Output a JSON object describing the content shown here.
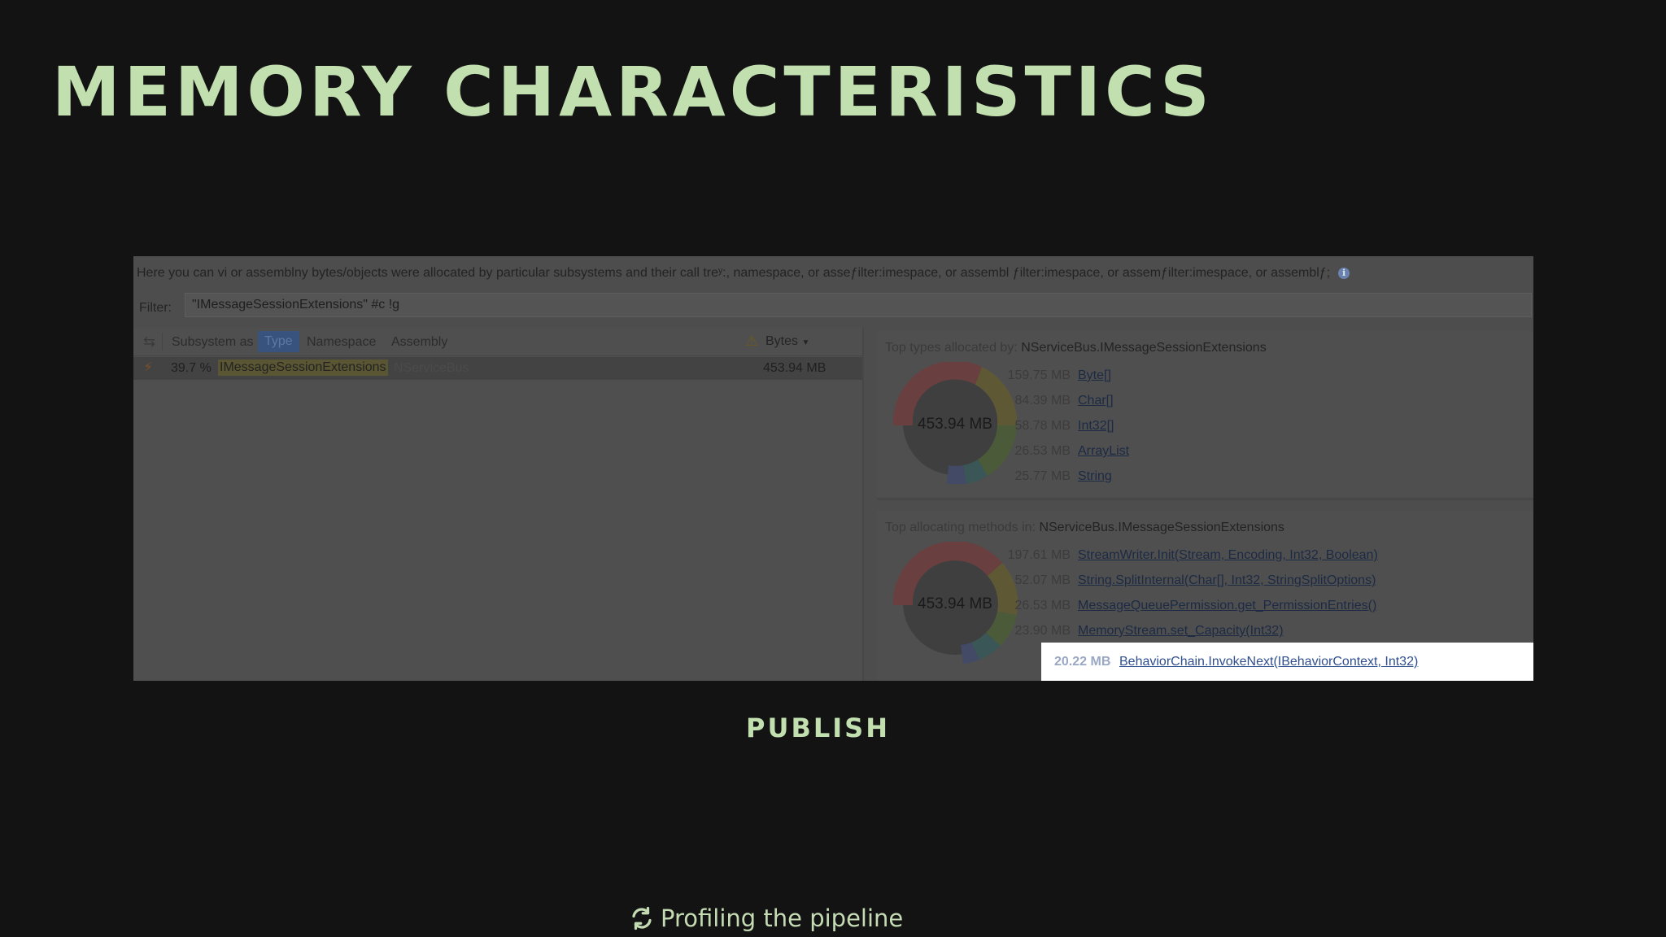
{
  "slide": {
    "title": "MEMORY CHARACTERISTICS",
    "caption": "PUBLISH",
    "footer": "Profiling the pipeline",
    "accent_color": "#c2dfb0"
  },
  "screenshot": {
    "hint": "Here you can vi or assemblny bytes/objects were allocated by particular subsystems and their call treʸ:, namespace, or asseƒilter:imespace, or assembl ƒilter:imespace, or assemƒilter:imespace, or assemblƒ;",
    "info_icon": "info-icon",
    "filter_label": "Filter:",
    "filter_value": "\"IMessageSessionExtensions\" #c !g",
    "toolbar": {
      "subsystem_as": "Subsystem as",
      "type": "Type",
      "namespace": "Namespace",
      "assembly": "Assembly",
      "bytes": "Bytes"
    },
    "rows": [
      {
        "percent": "39.7 %",
        "name": "IMessageSessionExtensions",
        "namespace": "NServiceBus",
        "bytes": "453.94 MB"
      }
    ],
    "top_types": {
      "caption_prefix": "Top types allocated by:",
      "caption_subject": "NServiceBus.IMessageSessionExtensions",
      "total": "453.94 MB",
      "items": [
        {
          "value": "159.75 MB",
          "name": "Byte[]"
        },
        {
          "value": "84.39 MB",
          "name": "Char[]"
        },
        {
          "value": "58.78 MB",
          "name": "Int32[]"
        },
        {
          "value": "26.53 MB",
          "name": "ArrayList"
        },
        {
          "value": "25.77 MB",
          "name": "String"
        }
      ]
    },
    "top_methods": {
      "caption_prefix": "Top allocating methods in:",
      "caption_subject": "NServiceBus.IMessageSessionExtensions",
      "total": "453.94 MB",
      "items": [
        {
          "value": "197.61 MB",
          "name": "StreamWriter.Init(Stream, Encoding, Int32, Boolean)"
        },
        {
          "value": "52.07 MB",
          "name": "String.SplitInternal(Char[], Int32, StringSplitOptions)"
        },
        {
          "value": "26.53 MB",
          "name": "MessageQueuePermission.get_PermissionEntries()"
        },
        {
          "value": "23.90 MB",
          "name": "MemoryStream.set_Capacity(Int32)"
        },
        {
          "value": "20.22 MB",
          "name": "BehaviorChain.InvokeNext(IBehaviorContext, Int32)"
        }
      ]
    }
  }
}
